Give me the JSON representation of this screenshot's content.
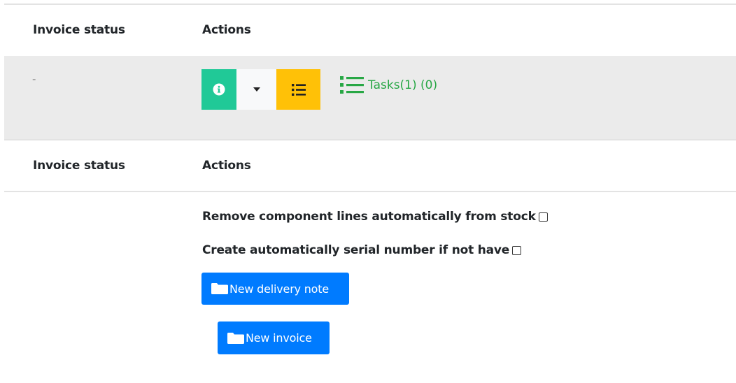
{
  "table1": {
    "header": {
      "col_invoice_status": "Invoice status",
      "col_actions": "Actions"
    },
    "row": {
      "invoice_status": "-",
      "info_button_icon": "info-icon",
      "dropdown_icon": "caret-down-icon",
      "list_button_icon": "list-icon",
      "tasks_link_label": "Tasks(1) (0)"
    }
  },
  "table2": {
    "header": {
      "col_invoice_status": "Invoice status",
      "col_actions": "Actions"
    }
  },
  "options": {
    "remove_component_lines_label": "Remove component lines automatically from stock",
    "remove_component_lines_checked": false,
    "create_serial_label": "Create automatically serial number if not have",
    "create_serial_checked": false
  },
  "buttons": {
    "new_delivery_note": "New delivery note",
    "new_invoice": "New invoice"
  },
  "colors": {
    "info_button": "#20c997",
    "dropdown_button": "#f8f9fa",
    "list_button": "#ffc107",
    "tasks_link": "#28a745",
    "primary_button": "#007bff",
    "row_shade": "#ebebeb"
  }
}
